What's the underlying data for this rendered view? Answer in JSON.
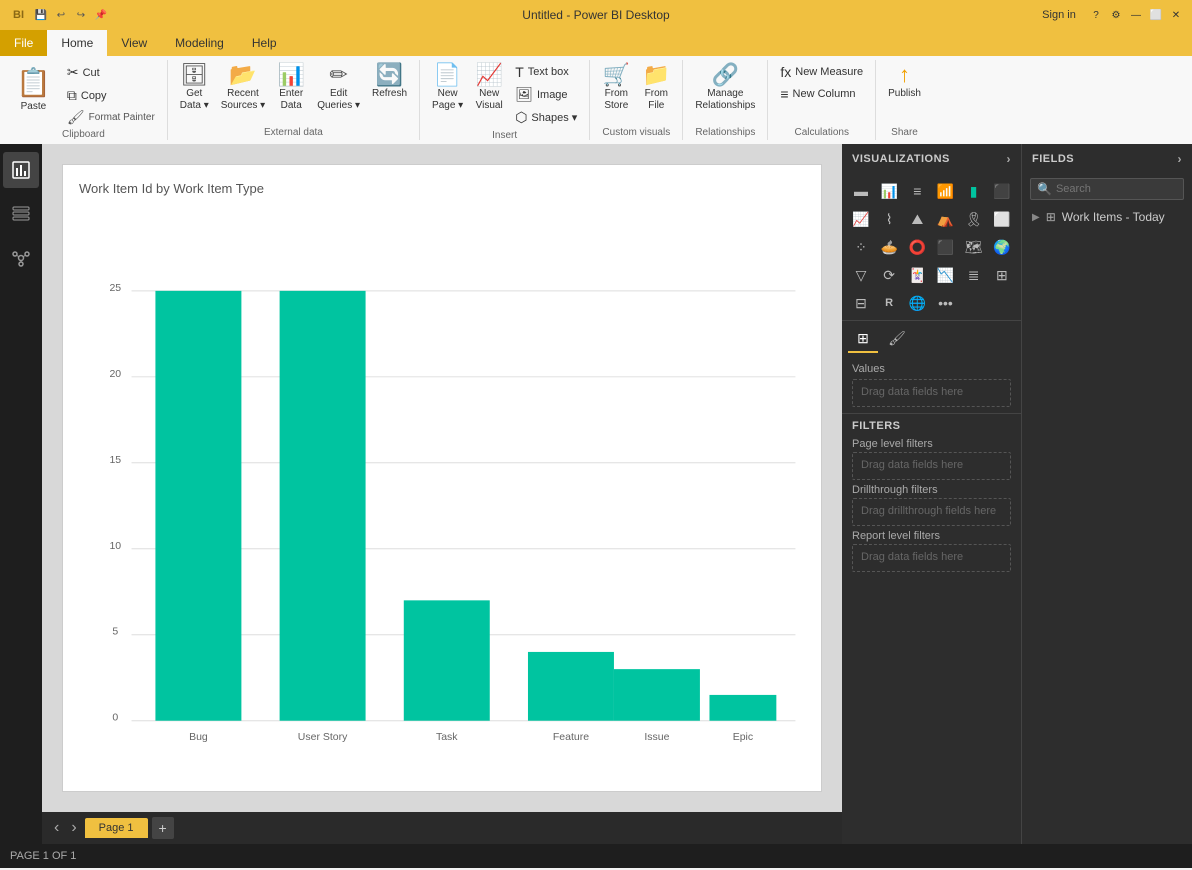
{
  "titleBar": {
    "title": "Untitled - Power BI Desktop",
    "logo": "BI"
  },
  "ribbonTabs": [
    "File",
    "Home",
    "View",
    "Modeling",
    "Help"
  ],
  "activeTab": "Home",
  "signIn": "Sign in",
  "clipboard": {
    "paste": "Paste",
    "cut": "Cut",
    "copy": "Copy",
    "formatPainter": "Format Painter",
    "groupLabel": "Clipboard"
  },
  "externalData": {
    "getData": "Get\nData",
    "recentSources": "Recent\nSources",
    "enterData": "Enter\nData",
    "editQueries": "Edit\nQueries",
    "refresh": "Refresh",
    "groupLabel": "External data"
  },
  "insert": {
    "newPage": "New\nPage",
    "newVisual": "New\nVisual",
    "textBox": "Text box",
    "image": "Image",
    "shapes": "Shapes",
    "groupLabel": "Insert"
  },
  "customVisuals": {
    "fromStore": "From\nStore",
    "fromFile": "From\nFile",
    "groupLabel": "Custom visuals"
  },
  "relationships": {
    "manage": "Manage\nRelationships",
    "groupLabel": "Relationships"
  },
  "calculations": {
    "newMeasure": "New Measure",
    "newColumn": "New Column",
    "groupLabel": "Calculations"
  },
  "share": {
    "publish": "Publish",
    "groupLabel": "Share"
  },
  "chart": {
    "title": "Work Item Id by Work Item Type",
    "bars": [
      {
        "label": "Bug",
        "value": 25
      },
      {
        "label": "User Story",
        "value": 25
      },
      {
        "label": "Task",
        "value": 7
      },
      {
        "label": "Feature",
        "value": 4
      },
      {
        "label": "Issue",
        "value": 3
      },
      {
        "label": "Epic",
        "value": 1.5
      }
    ],
    "yMax": 25,
    "yTicks": [
      0,
      5,
      10,
      15,
      20,
      25
    ],
    "barColor": "#00c4a0"
  },
  "visualizations": {
    "panelTitle": "VISUALIZATIONS",
    "valuesLabel": "Values",
    "dragFieldsText": "Drag data fields here",
    "dragDrillthrough": "Drag drillthrough fields here",
    "filters": {
      "title": "FILTERS",
      "pageLevelFilters": "Page level filters",
      "pageDrag": "Drag data fields here",
      "drillthroughFilters": "Drillthrough filters",
      "drillthroughDrag": "Drag drillthrough fields here",
      "reportLevelFilters": "Report level filters",
      "reportDrag": "Drag data fields here"
    }
  },
  "fields": {
    "panelTitle": "FIELDS",
    "searchPlaceholder": "Search",
    "items": [
      {
        "name": "Work Items - Today",
        "type": "table"
      }
    ]
  },
  "pages": {
    "current": 1,
    "total": 1,
    "tabs": [
      "Page 1"
    ],
    "statusLabel": "PAGE 1 OF 1"
  }
}
